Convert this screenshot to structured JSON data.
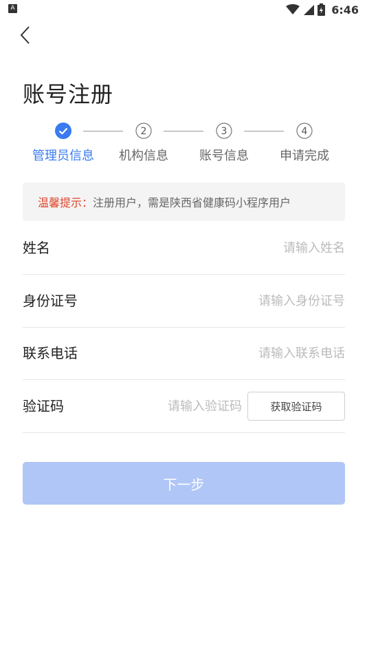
{
  "status_bar": {
    "time": "6:46",
    "app_badge": "A"
  },
  "header": {
    "title": "账号注册"
  },
  "steps": [
    {
      "number": "",
      "label": "管理员信息",
      "state": "done"
    },
    {
      "number": "2",
      "label": "机构信息",
      "state": "pending"
    },
    {
      "number": "3",
      "label": "账号信息",
      "state": "pending"
    },
    {
      "number": "4",
      "label": "申请完成",
      "state": "pending"
    }
  ],
  "tip": {
    "prefix": "温馨提示：",
    "text": "注册用户，需是陕西省健康码小程序用户"
  },
  "form": {
    "name": {
      "label": "姓名",
      "placeholder": "请输入姓名"
    },
    "id_number": {
      "label": "身份证号",
      "placeholder": "请输入身份证号"
    },
    "phone": {
      "label": "联系电话",
      "placeholder": "请输入联系电话"
    },
    "code": {
      "label": "验证码",
      "placeholder": "请输入验证码",
      "button": "获取验证码"
    }
  },
  "next_button": {
    "label": "下一步"
  },
  "colors": {
    "accent": "#3a7bf2",
    "tip_key": "#e0452b",
    "button_disabled": "#b0c6f6"
  }
}
